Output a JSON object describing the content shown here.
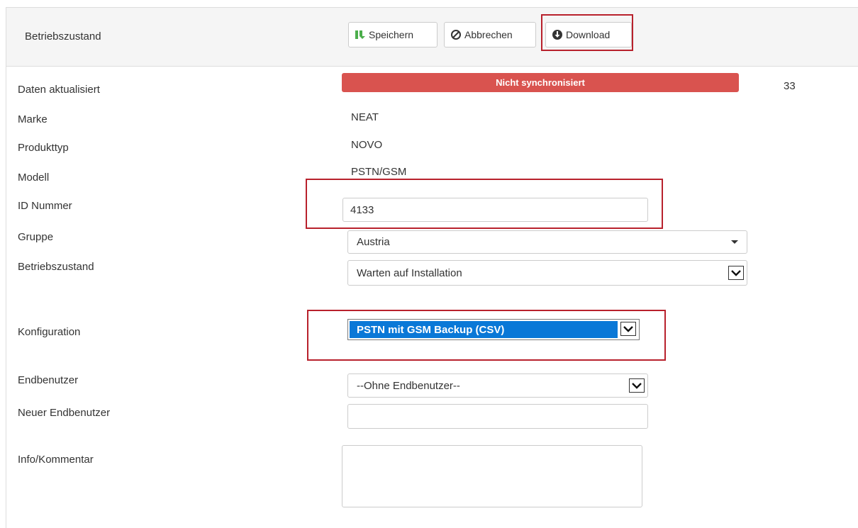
{
  "header": {
    "title": "Betriebszustand",
    "buttons": {
      "save": "Speichern",
      "cancel": "Abbrechen",
      "download": "Download"
    }
  },
  "fields": {
    "data_updated": {
      "label": "Daten aktualisiert",
      "status": "Nicht synchronisiert",
      "count": "33"
    },
    "brand": {
      "label": "Marke",
      "value": "NEAT"
    },
    "product_type": {
      "label": "Produkttyp",
      "value": "NOVO"
    },
    "model": {
      "label": "Modell",
      "value": "PSTN/GSM"
    },
    "id_number": {
      "label": "ID Nummer",
      "value": "4133"
    },
    "group": {
      "label": "Gruppe",
      "selected": "Austria"
    },
    "operating_state": {
      "label": "Betriebszustand",
      "selected": "Warten auf Installation"
    },
    "configuration": {
      "label": "Konfiguration",
      "selected": "PSTN mit GSM Backup (CSV)"
    },
    "end_user": {
      "label": "Endbenutzer",
      "selected": "--Ohne Endbenutzer--"
    },
    "new_end_user": {
      "label": "Neuer Endbenutzer",
      "value": ""
    },
    "info_comment": {
      "label": "Info/Kommentar",
      "value": ""
    }
  },
  "colors": {
    "status_bar": "#d9534f",
    "highlight_box": "#b8212c",
    "save_icon": "#4cae4c",
    "selection": "#0a78d7"
  },
  "icons": {
    "save": "save-icon",
    "cancel": "ban-icon",
    "download": "download-circle-icon"
  }
}
